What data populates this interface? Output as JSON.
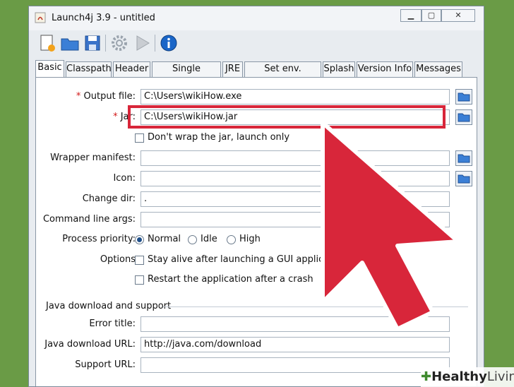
{
  "window": {
    "title": "Launch4j 3.9 - untitled",
    "controls": [
      "minimize-icon",
      "maximize-icon",
      "close-icon"
    ]
  },
  "toolbar": [
    "new-file-icon",
    "open-folder-icon",
    "save-icon",
    "gear-icon",
    "play-icon",
    "info-icon"
  ],
  "tabs": [
    {
      "label": "Basic",
      "active": true
    },
    {
      "label": "Classpath"
    },
    {
      "label": "Header"
    },
    {
      "label": "Single instance"
    },
    {
      "label": "JRE"
    },
    {
      "label": "Set env. variables"
    },
    {
      "label": "Splash"
    },
    {
      "label": "Version Info"
    },
    {
      "label": "Messages"
    }
  ],
  "form": {
    "output_file": {
      "required_mark": "*",
      "label": "Output file:",
      "value": "C:\\Users\\wikiHow.exe"
    },
    "jar": {
      "required_mark": "*",
      "label": "Jar:",
      "value": "C:\\Users\\wikiHow.jar"
    },
    "dont_wrap": {
      "label": "Don't wrap the jar, launch only",
      "checked": false
    },
    "wrapper_manifest": {
      "label": "Wrapper manifest:",
      "value": ""
    },
    "icon": {
      "label": "Icon:",
      "value": ""
    },
    "change_dir": {
      "label": "Change dir:",
      "value": "."
    },
    "command_line_args": {
      "label": "Command line args:",
      "value": ""
    },
    "process_priority": {
      "label": "Process priority:",
      "options": [
        "Normal",
        "Idle",
        "High"
      ],
      "selected": "Normal"
    },
    "options": {
      "label": "Options",
      "stay_alive": "Stay alive after launching a GUI application",
      "restart": "Restart the application after a crash"
    },
    "java_section": {
      "title": "Java download and support"
    },
    "error_title": {
      "label": "Error title:",
      "value": ""
    },
    "java_download_url": {
      "label": "Java download URL:",
      "value": "http://java.com/download"
    },
    "support_url": {
      "label": "Support URL:",
      "value": ""
    }
  },
  "overlay": {
    "highlight_color": "#d8263a",
    "arrow_color": "#d8263a"
  },
  "watermark": {
    "brand": "Healthy",
    "suffix": "Living"
  }
}
